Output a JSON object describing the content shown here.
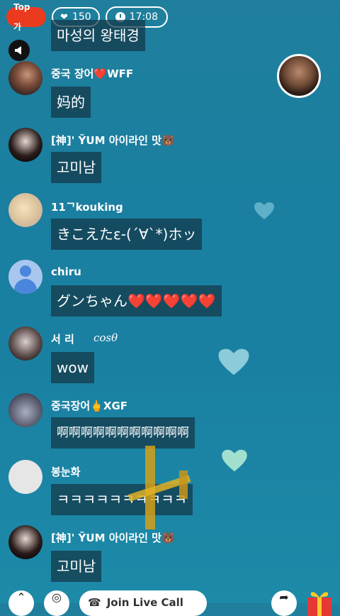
{
  "top_bar": {
    "rank_label": "Top 가",
    "likes": "150",
    "time": "17:08"
  },
  "chat": [
    {
      "user": "",
      "message": "마성의 왕태경"
    },
    {
      "user": "중국 장어❤️WFF",
      "message": "妈的"
    },
    {
      "user": "[神]' ỸUM 아이라인 맛🐻",
      "message": "고미남"
    },
    {
      "user": "11ᄀkouking",
      "message": "きこえたε-(´∀`*)ホッ"
    },
    {
      "user": "chiru",
      "message": "グンちゃん❤️❤️❤️❤️❤️"
    },
    {
      "user": "서 리",
      "user_extra": "cosθ",
      "message": "wow"
    },
    {
      "user": "중국장어🖕XGF",
      "message": "啊啊啊啊啊啊啊啊啊啊啊"
    },
    {
      "user": "봉눈화",
      "message": "ㅋㅋㅋㅋㅋㅋㅋㅋㅋㅋ"
    },
    {
      "user": "[神]' ỸUM 아이라인 맛🐻",
      "message": "고미남"
    }
  ],
  "bottom_bar": {
    "join_label": "Join Live Call"
  },
  "colors": {
    "rank_pill": "#ea3b1e",
    "background": "#1a7fa0",
    "bubble": "#14374680"
  },
  "icons": [
    "heart-icon",
    "clock-icon",
    "megaphone-icon",
    "gift-icon",
    "share-icon",
    "chevron-up-icon",
    "chat-icon",
    "phone-icon"
  ]
}
